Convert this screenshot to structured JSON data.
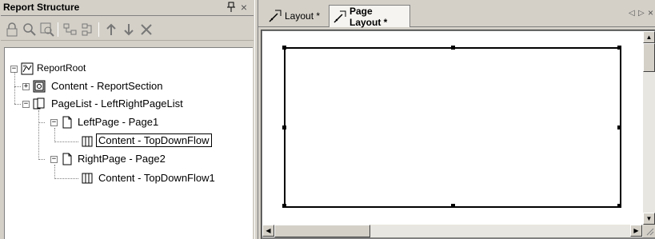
{
  "panel": {
    "title": "Report Structure",
    "pin_glyph": "📌",
    "close_glyph": "×"
  },
  "toolbar": {
    "buttons": [
      {
        "name": "lock-icon"
      },
      {
        "name": "zoom-icon"
      },
      {
        "name": "zoom-region-icon"
      },
      {
        "name": "link-icon"
      },
      {
        "name": "unlink-icon"
      },
      {
        "name": "move-up-icon"
      },
      {
        "name": "move-down-icon"
      },
      {
        "name": "delete-icon"
      }
    ]
  },
  "tree": {
    "nodes": [
      {
        "label": "ReportRoot",
        "icon": "report-root-icon",
        "expander": "−"
      },
      {
        "label": "Content - ReportSection",
        "icon": "report-section-icon",
        "expander": "+"
      },
      {
        "label": "PageList - LeftRightPageList",
        "icon": "page-list-icon",
        "expander": "−"
      },
      {
        "label": "LeftPage - Page1",
        "icon": "page-icon",
        "expander": "−"
      },
      {
        "label": "Content - TopDownFlow",
        "icon": "flow-icon",
        "expander": ""
      },
      {
        "label": "RightPage - Page2",
        "icon": "page-icon",
        "expander": "−"
      },
      {
        "label": "Content - TopDownFlow1",
        "icon": "flow-icon",
        "expander": ""
      }
    ]
  },
  "tabs": [
    {
      "label": "Layout *",
      "active": false
    },
    {
      "label": "Page Layout *",
      "active": true
    }
  ],
  "tab_nav": {
    "prev": "◁",
    "next": "▷",
    "close": "×"
  },
  "scroll": {
    "up": "▲",
    "down": "▼",
    "left": "◀",
    "right": "▶"
  },
  "colors": {
    "chrome": "#d4d0c8",
    "canvas_bg": "#808080",
    "page_bg": "#ffffff",
    "active_tab": "#f5f4f0"
  }
}
